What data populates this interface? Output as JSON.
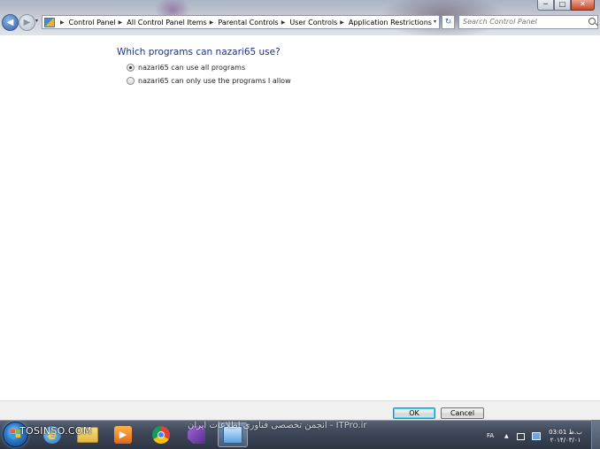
{
  "window": {
    "controls": {
      "minimize": "─",
      "maximize": "□",
      "close": "✕"
    }
  },
  "nav": {
    "back_glyph": "◀",
    "forward_glyph": "▶",
    "dropdown_glyph": "▾"
  },
  "address": {
    "separator": "▶",
    "breadcrumbs": [
      "Control Panel",
      "All Control Panel Items",
      "Parental Controls",
      "User Controls",
      "Application Restrictions"
    ],
    "dropdown_glyph": "▾",
    "refresh_glyph": "↻"
  },
  "search": {
    "placeholder": "Search Control Panel",
    "icon": "search-icon"
  },
  "main": {
    "heading": "Which programs can nazari65 use?",
    "options": [
      {
        "label": "nazari65 can use all programs",
        "selected": true
      },
      {
        "label": "nazari65 can only use the programs I allow",
        "selected": false
      }
    ]
  },
  "buttons": {
    "ok": "OK",
    "cancel": "Cancel"
  },
  "taskbar": {
    "icons": [
      "start-orb-icon",
      "internet-explorer-icon",
      "folder-icon",
      "media-player-icon",
      "chrome-icon",
      "visual-studio-icon",
      "control-panel-icon"
    ],
    "language": "FA",
    "tray_up_glyph": "▲",
    "clock_time": "03:01 ب.ظ",
    "clock_date": "۲۰۱۴/۰۳/۰۱"
  },
  "watermarks": {
    "left": "TOSINSO.COM",
    "middle": "ITPro.ir - انجمن تخصصی فناوری اطلاعات ایران"
  },
  "colors": {
    "heading": "#1e3287",
    "ok_focus": "#3c7fb1",
    "taskbar": "#3e4859"
  }
}
